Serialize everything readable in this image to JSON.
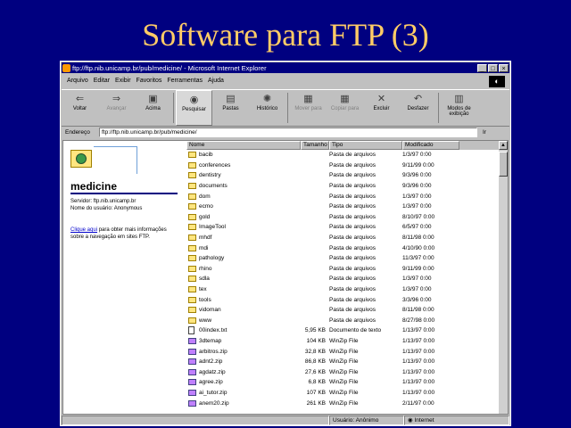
{
  "slide": {
    "title": "Software para FTP (3)"
  },
  "window": {
    "title": "ftp://ftp.nib.unicamp.br/pub/medicine/ - Microsoft Internet Explorer",
    "buttons": {
      "minimize": "_",
      "maximize": "□",
      "close": "×"
    }
  },
  "menu": [
    "Arquivo",
    "Editar",
    "Exibir",
    "Favoritos",
    "Ferramentas",
    "Ajuda"
  ],
  "toolbar": [
    {
      "label": "Voltar",
      "icon": "back-arrow-icon",
      "glyph": "⇐",
      "state": "normal"
    },
    {
      "label": "Avançar",
      "icon": "forward-arrow-icon",
      "glyph": "⇒",
      "state": "disabled"
    },
    {
      "label": "Acima",
      "icon": "up-folder-icon",
      "glyph": "▣",
      "state": "normal"
    },
    {
      "label": "Pesquisar",
      "icon": "search-globe-icon",
      "glyph": "◉",
      "state": "active"
    },
    {
      "label": "Pastas",
      "icon": "folders-icon",
      "glyph": "▤",
      "state": "normal"
    },
    {
      "label": "Histórico",
      "icon": "history-icon",
      "glyph": "✺",
      "state": "normal"
    },
    {
      "label": "Mover para",
      "icon": "move-to-icon",
      "glyph": "▦",
      "state": "disabled"
    },
    {
      "label": "Copiar para",
      "icon": "copy-to-icon",
      "glyph": "▦",
      "state": "disabled"
    },
    {
      "label": "Excluir",
      "icon": "delete-icon",
      "glyph": "✕",
      "state": "normal"
    },
    {
      "label": "Desfazer",
      "icon": "undo-icon",
      "glyph": "↶",
      "state": "normal"
    },
    {
      "label": "Modos de exibição",
      "icon": "views-icon",
      "glyph": "▥",
      "state": "normal"
    }
  ],
  "address": {
    "label": "Endereço",
    "value": "ftp://ftp.nib.unicamp.br/pub/medicine/",
    "go_label": "Ir"
  },
  "left_pane": {
    "folder_name": "medicine",
    "server_text": "Servidor: ftp.nib.unicamp.br",
    "user_text": "Nome do usuário: Anonymous",
    "link_text": "Clique aqui",
    "link_rest": "para obter mais informações sobre a navegação em sites FTP."
  },
  "columns": [
    "Nome",
    "Tamanho",
    "Tipo",
    "Modificado"
  ],
  "files": [
    {
      "name": "bacib",
      "size": "",
      "type": "Pasta de arquivos",
      "modified": "1/3/97 0:00",
      "kind": "folder"
    },
    {
      "name": "conferences",
      "size": "",
      "type": "Pasta de arquivos",
      "modified": "9/11/99 0:00",
      "kind": "folder"
    },
    {
      "name": "dentistry",
      "size": "",
      "type": "Pasta de arquivos",
      "modified": "9/3/96 0:00",
      "kind": "folder"
    },
    {
      "name": "documents",
      "size": "",
      "type": "Pasta de arquivos",
      "modified": "9/3/96 0:00",
      "kind": "folder"
    },
    {
      "name": "dom",
      "size": "",
      "type": "Pasta de arquivos",
      "modified": "1/3/97 0:00",
      "kind": "folder"
    },
    {
      "name": "ecmo",
      "size": "",
      "type": "Pasta de arquivos",
      "modified": "1/3/97 0:00",
      "kind": "folder"
    },
    {
      "name": "gold",
      "size": "",
      "type": "Pasta de arquivos",
      "modified": "8/10/97 0:00",
      "kind": "folder"
    },
    {
      "name": "ImageTool",
      "size": "",
      "type": "Pasta de arquivos",
      "modified": "6/5/97 0:00",
      "kind": "folder"
    },
    {
      "name": "mhdf",
      "size": "",
      "type": "Pasta de arquivos",
      "modified": "8/11/98 0:00",
      "kind": "folder"
    },
    {
      "name": "mdi",
      "size": "",
      "type": "Pasta de arquivos",
      "modified": "4/10/90 0:00",
      "kind": "folder"
    },
    {
      "name": "pathology",
      "size": "",
      "type": "Pasta de arquivos",
      "modified": "11/3/97 0:00",
      "kind": "folder"
    },
    {
      "name": "rhino",
      "size": "",
      "type": "Pasta de arquivos",
      "modified": "9/11/99 0:00",
      "kind": "folder"
    },
    {
      "name": "sdla",
      "size": "",
      "type": "Pasta de arquivos",
      "modified": "1/3/97 0:00",
      "kind": "folder"
    },
    {
      "name": "tex",
      "size": "",
      "type": "Pasta de arquivos",
      "modified": "1/3/97 0:00",
      "kind": "folder"
    },
    {
      "name": "tools",
      "size": "",
      "type": "Pasta de arquivos",
      "modified": "3/3/96 0:00",
      "kind": "folder"
    },
    {
      "name": "vidoman",
      "size": "",
      "type": "Pasta de arquivos",
      "modified": "8/11/98 0:00",
      "kind": "folder"
    },
    {
      "name": "www",
      "size": "",
      "type": "Pasta de arquivos",
      "modified": "8/27/98 0:00",
      "kind": "folder"
    },
    {
      "name": "00index.txt",
      "size": "5,95 KB",
      "type": "Documento de texto",
      "modified": "1/13/97 0:00",
      "kind": "doc"
    },
    {
      "name": "3dtemap",
      "size": "104 KB",
      "type": "WinZip File",
      "modified": "1/13/97 0:00",
      "kind": "zip"
    },
    {
      "name": "arbitros.zip",
      "size": "32,8 KB",
      "type": "WinZip File",
      "modified": "1/13/97 0:00",
      "kind": "zip"
    },
    {
      "name": "adnt2.zip",
      "size": "86,8 KB",
      "type": "WinZip File",
      "modified": "1/13/97 0:00",
      "kind": "zip"
    },
    {
      "name": "agdatz.zip",
      "size": "27,6 KB",
      "type": "WinZip File",
      "modified": "1/13/97 0:00",
      "kind": "zip"
    },
    {
      "name": "agree.zip",
      "size": "6,8 KB",
      "type": "WinZip File",
      "modified": "1/13/97 0:00",
      "kind": "zip"
    },
    {
      "name": "ai_tutor.zip",
      "size": "107 KB",
      "type": "WinZip File",
      "modified": "1/13/97 0:00",
      "kind": "zip"
    },
    {
      "name": "anem20.zip",
      "size": "261 KB",
      "type": "WinZip File",
      "modified": "2/11/97 0:00",
      "kind": "zip"
    }
  ],
  "status": {
    "user": "Usuário: Anônimo",
    "zone": "Internet"
  }
}
